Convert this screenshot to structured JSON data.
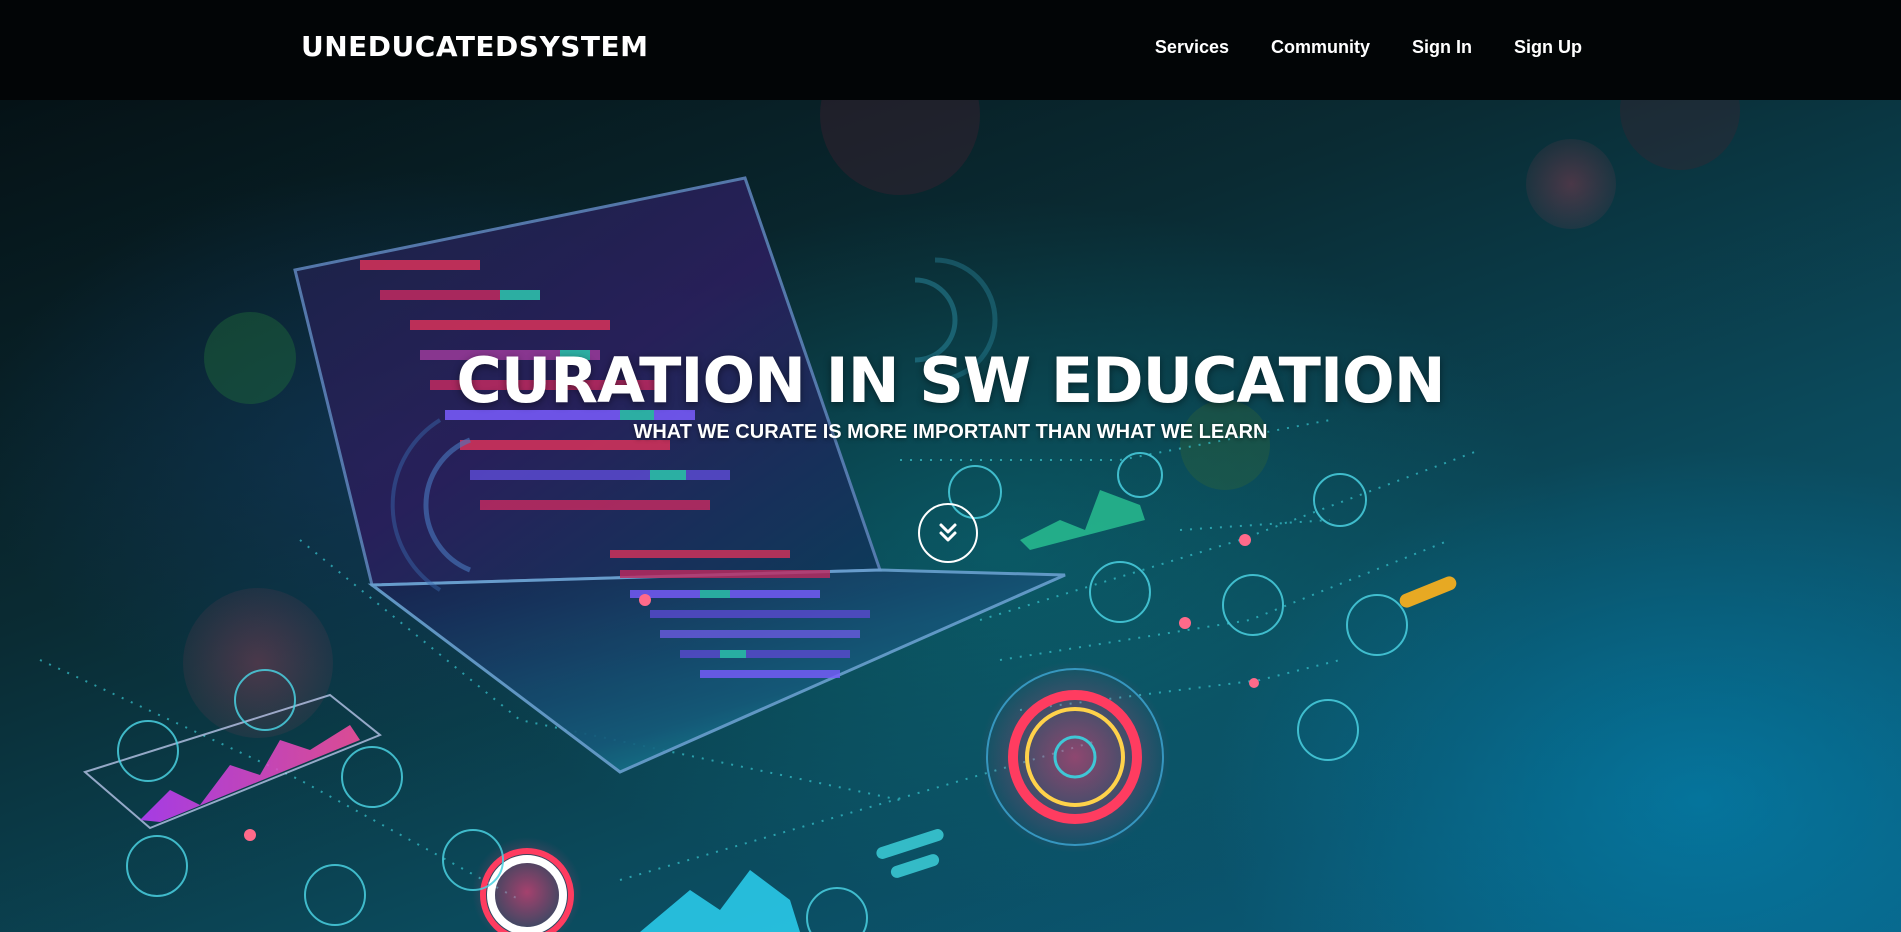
{
  "brand": "UNEDUCATEDSYSTEM",
  "nav": {
    "items": [
      {
        "label": "Services"
      },
      {
        "label": "Community"
      },
      {
        "label": "Sign In"
      },
      {
        "label": "Sign Up"
      }
    ]
  },
  "hero": {
    "title": "CURATION IN SW EDUCATION",
    "subtitle": "WHAT WE CURATE IS MORE IMPORTANT THAN WHAT WE LEARN",
    "scroll_icon": "chevron-double-down-icon"
  },
  "colors": {
    "navbar_bg": "#020506",
    "text": "#ffffff",
    "accent_teal": "#1ec8c8",
    "accent_pink": "#ff3c78",
    "accent_purple": "#7a5cff"
  }
}
